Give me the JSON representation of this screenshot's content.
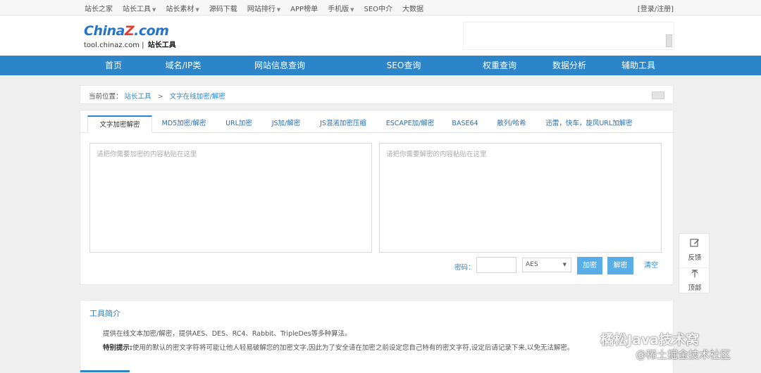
{
  "topbar": {
    "items": [
      {
        "label": "站长之家",
        "caret": false
      },
      {
        "label": "站长工具",
        "caret": true
      },
      {
        "label": "站长素材",
        "caret": true
      },
      {
        "label": "源码下载",
        "caret": false
      },
      {
        "label": "网站排行",
        "caret": true
      },
      {
        "label": "APP榜单",
        "caret": false
      },
      {
        "label": "手机版",
        "caret": true
      },
      {
        "label": "SEO中介",
        "caret": false
      },
      {
        "label": "大数据",
        "caret": false
      }
    ],
    "login": "[登录/注册]"
  },
  "logo": {
    "brand_a": "China",
    "brand_z": "Z",
    "brand_b": ".com",
    "domain": "tool.chinaz.com",
    "sep": "|",
    "suffix": "站长工具"
  },
  "mainnav": {
    "items": [
      "首页",
      "域名/IP类",
      "网站信息查询",
      "SEO查询",
      "权重查询",
      "数据分析",
      "辅助工具"
    ]
  },
  "breadcrumb": {
    "prefix": "当前位置：",
    "root": "站长工具",
    "sep": ">",
    "current": "文字在线加密/解密"
  },
  "tabs": {
    "items": [
      "文字加密解密",
      "MD5加密/解密",
      "URL加密",
      "JS加/解密",
      "JS混淆加密压缩",
      "ESCAPE加/解密",
      "BASE64",
      "散列/哈希",
      "迅雷，快车，旋风URL加解密"
    ],
    "active": 0
  },
  "editor": {
    "encrypt_placeholder": "请把你需要加密的内容粘贴在这里",
    "decrypt_placeholder": "请把你需要解密的内容粘贴在这里",
    "password_label": "密码：",
    "password_value": "",
    "algorithm": "AES",
    "encrypt_button": "加密",
    "decrypt_button": "解密",
    "clear_button": "清空"
  },
  "side": {
    "feedback": "反馈",
    "top": "顶部",
    "feedback_icon": "edit-icon",
    "top_icon": "arrow-up-icon"
  },
  "intro": {
    "title": "工具简介",
    "line1": "提供在线文本加密/解密，提供AES、DES、RC4、Rabbit、TripleDes等多种算法。",
    "line2_bold": "特别提示:",
    "line2": "使用的默认的密文字符将可能让他人轻易破解您的加密文字,因此为了安全请在加密之前设定您自己特有的密文字符,设定后请记录下来,以免无法解密。"
  },
  "watermark": {
    "line1": "橘松Java技术窝",
    "line2": "@稀土掘金技术社区"
  },
  "colors": {
    "nav_blue": "#2c84c9",
    "button_blue": "#5aaee7",
    "logo_blue": "#2375c9",
    "logo_red": "#e63c30"
  }
}
